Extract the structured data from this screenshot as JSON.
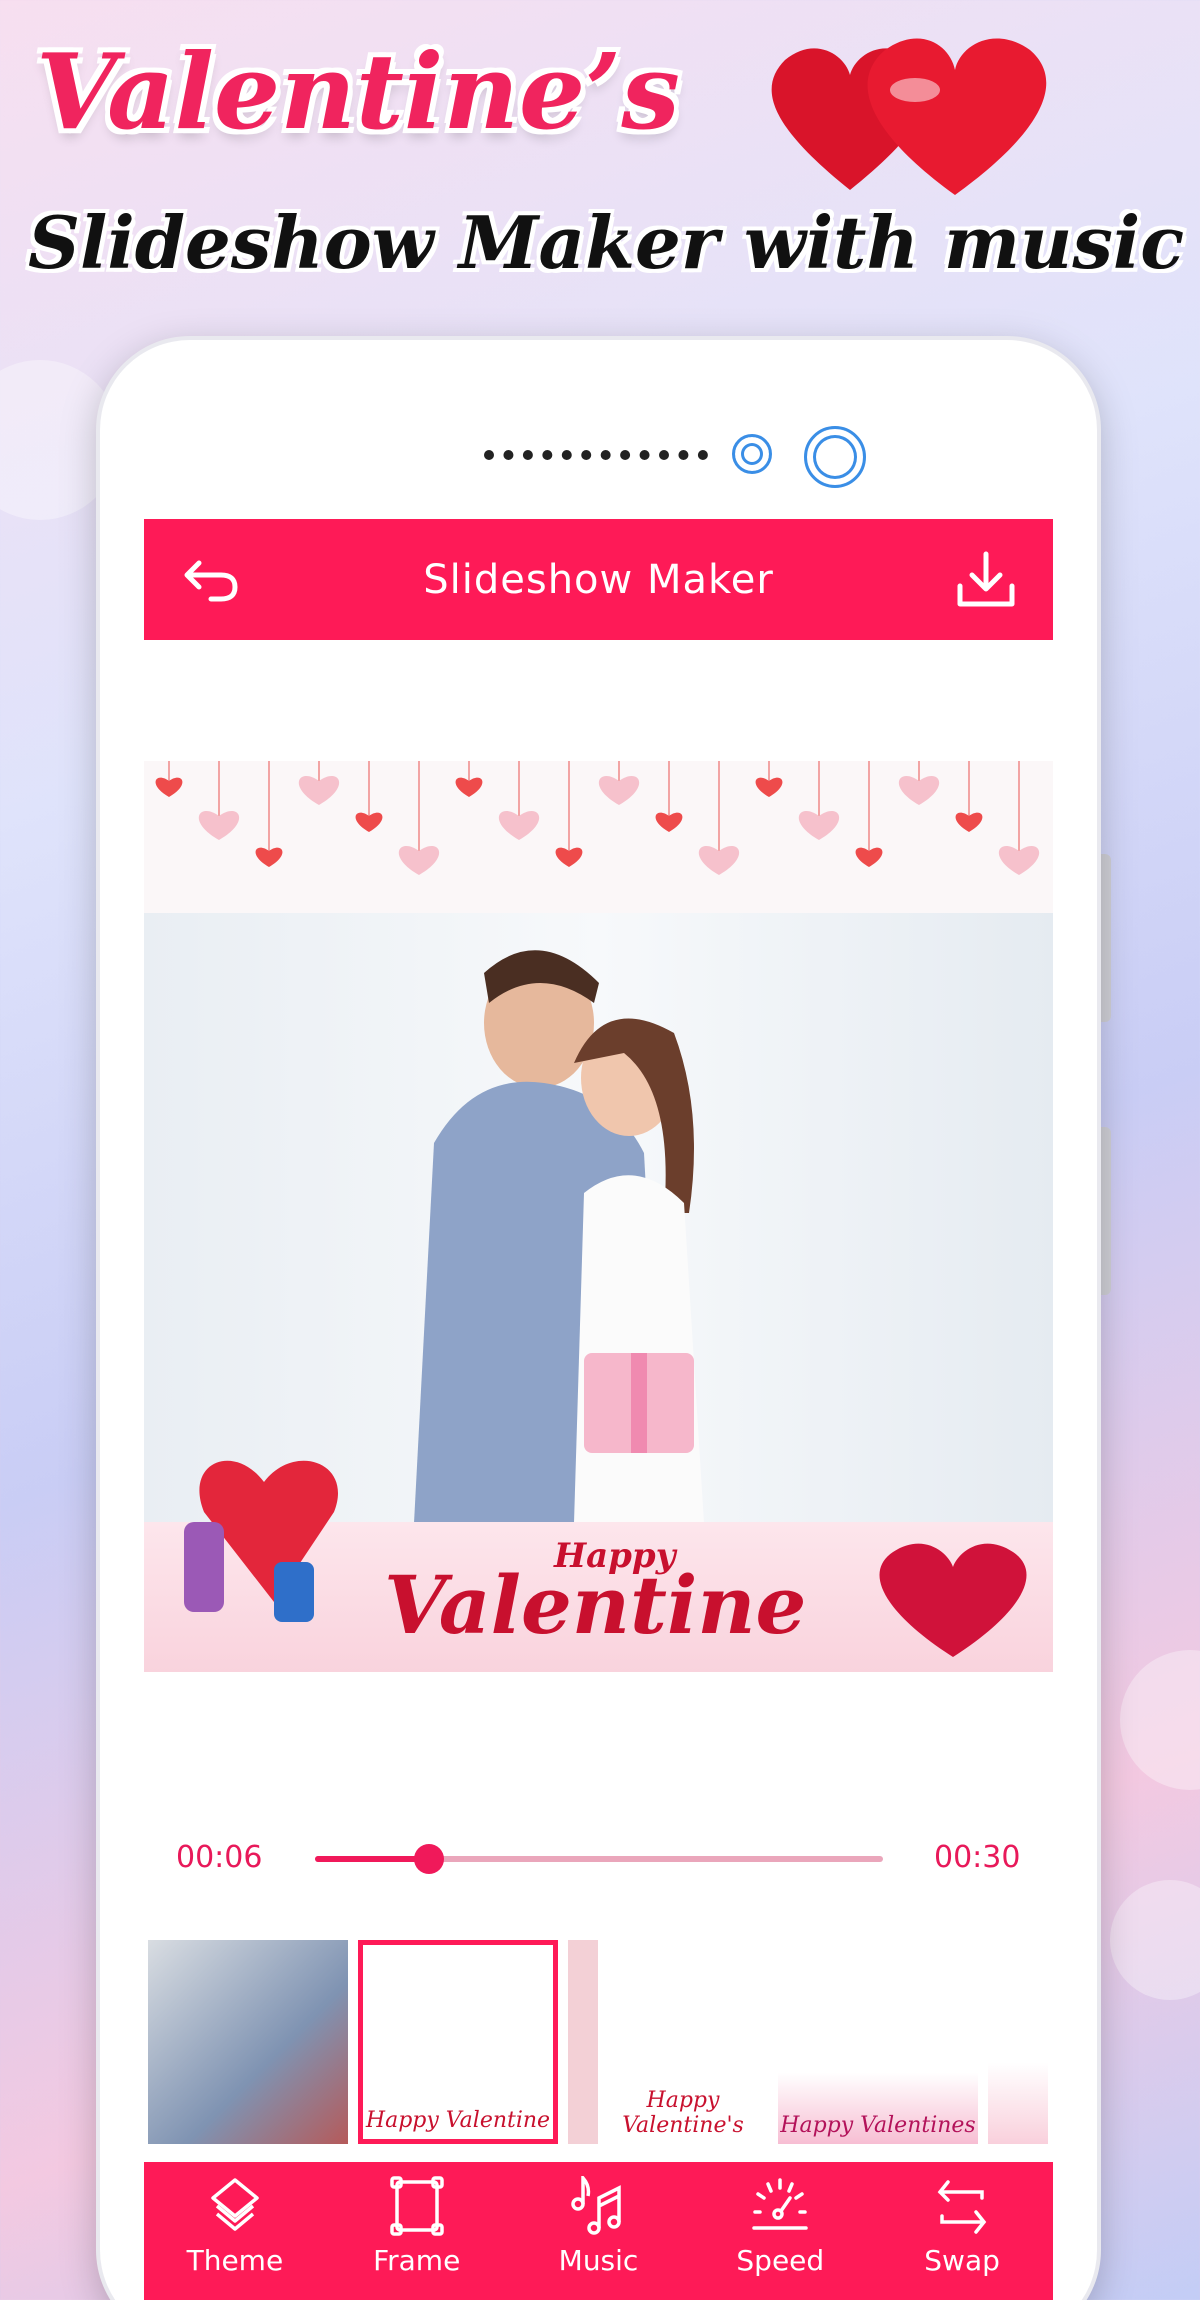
{
  "promo": {
    "title": "Valentine’s",
    "subtitle": "Slideshow Maker with music"
  },
  "header": {
    "title": "Slideshow Maker",
    "back_icon": "back-arrow-icon",
    "download_icon": "download-icon"
  },
  "preview": {
    "banner_small": "Happy",
    "banner_text": "Valentine"
  },
  "timeline": {
    "current": "00:06",
    "total": "00:30",
    "progress_percent": 20
  },
  "thumbnails": [
    {
      "caption": "",
      "selected": false
    },
    {
      "caption": "Happy Valentine",
      "selected": true
    },
    {
      "caption": "Happy Valentine's",
      "selected": false
    },
    {
      "caption": "Happy Valentines",
      "selected": false
    }
  ],
  "nav": [
    {
      "label": "Theme",
      "icon": "layers-icon"
    },
    {
      "label": "Frame",
      "icon": "frame-icon"
    },
    {
      "label": "Music",
      "icon": "music-note-icon"
    },
    {
      "label": "Speed",
      "icon": "speedometer-icon"
    },
    {
      "label": "Swap",
      "icon": "swap-icon"
    }
  ],
  "colors": {
    "accent": "#fe1a57",
    "track": "#eaa6bb"
  }
}
